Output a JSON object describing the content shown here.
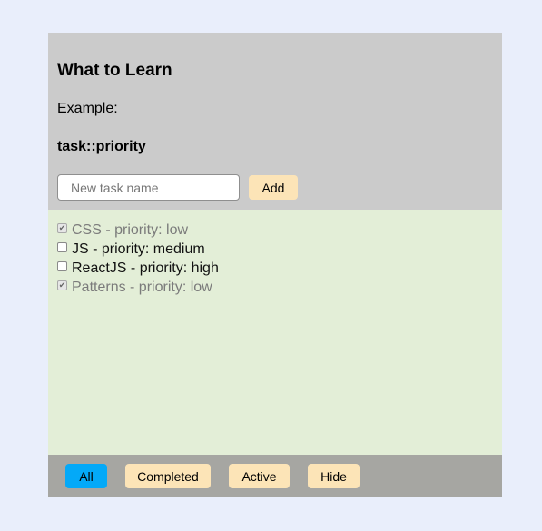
{
  "header": {
    "title": "What to Learn",
    "example_label": "Example:",
    "format": "task::priority",
    "input_placeholder": "New task name",
    "input_value": "",
    "add_label": "Add"
  },
  "tasks": [
    {
      "text": "CSS - priority: low",
      "completed": true
    },
    {
      "text": "JS - priority: medium",
      "completed": false
    },
    {
      "text": "ReactJS - priority: high",
      "completed": false
    },
    {
      "text": "Patterns - priority: low",
      "completed": true
    }
  ],
  "footer": {
    "all_label": "All",
    "completed_label": "Completed",
    "active_label": "Active",
    "hide_label": "Hide",
    "selected": "All"
  },
  "colors": {
    "page_bg": "#e9eefb",
    "header_bg": "#cbcbcb",
    "list_bg": "#e3eed7",
    "footer_bg": "#a6a6a2",
    "button_bg": "#fce4b7",
    "selected_button_bg": "#04a9f8"
  },
  "icons": {
    "checked": "checkmark-icon"
  }
}
